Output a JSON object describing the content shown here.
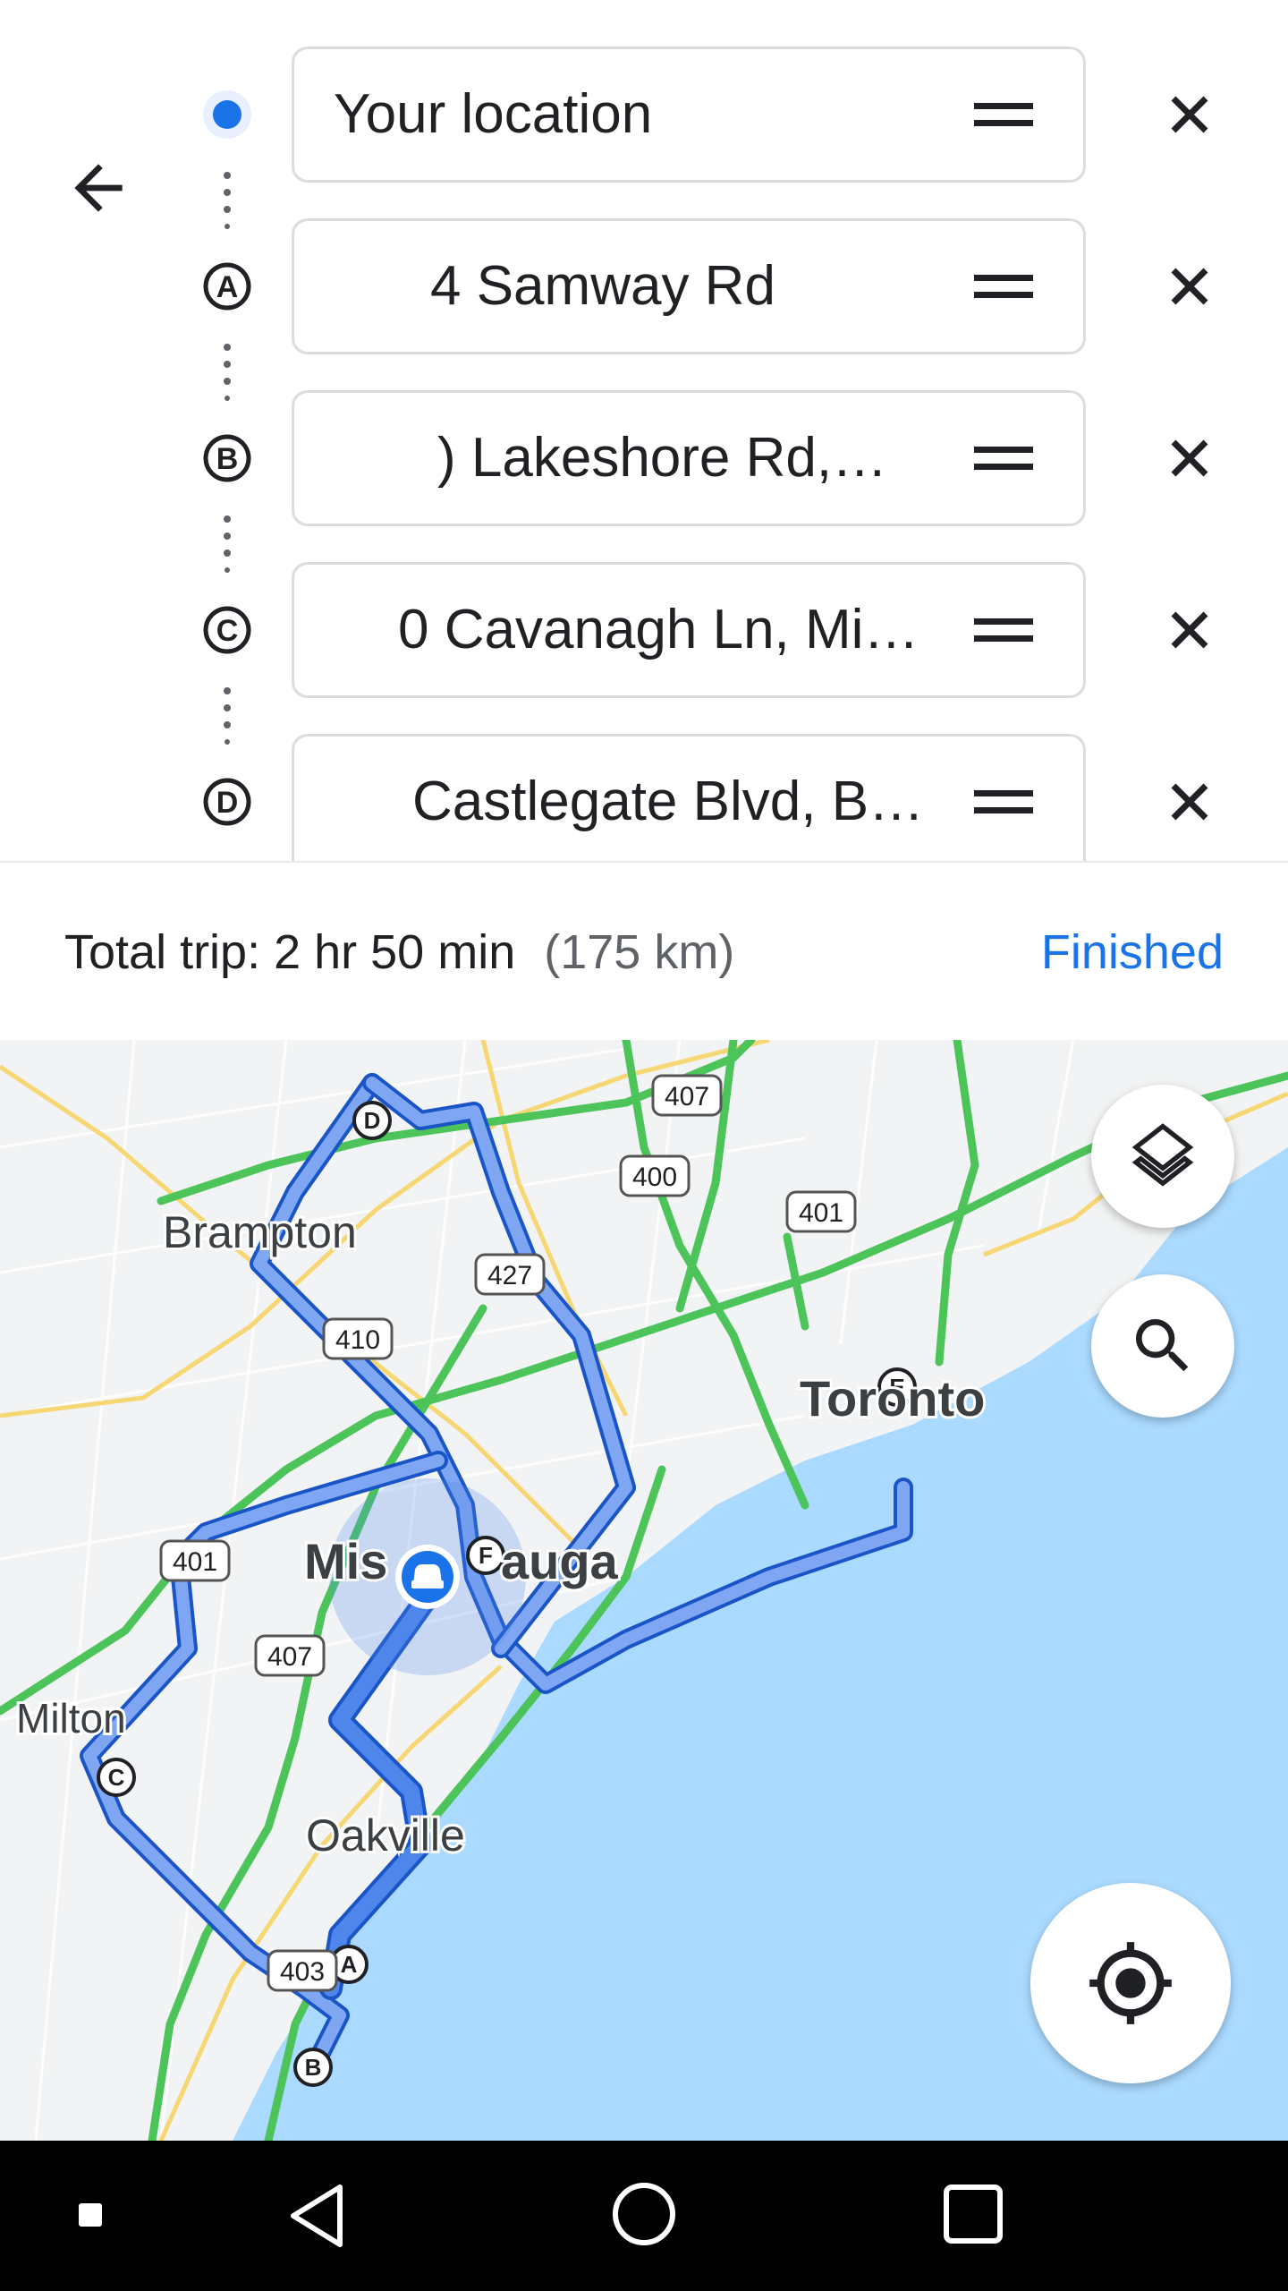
{
  "directions": {
    "stops": [
      {
        "marker": "",
        "text": "Your location"
      },
      {
        "marker": "A",
        "text": "4 Samway Rd"
      },
      {
        "marker": "B",
        "text": ") Lakeshore Rd,…"
      },
      {
        "marker": "C",
        "text": "0 Cavanagh Ln, Mi…"
      },
      {
        "marker": "D",
        "text": "Castlegate Blvd, B…"
      }
    ]
  },
  "summary": {
    "trip_label": "Total trip: 2 hr 50 min",
    "distance": "(175 km)",
    "finished_label": "Finished"
  },
  "map": {
    "cities": [
      "Brampton",
      "Toronto",
      "Mis",
      "auga",
      "Milton",
      "Oakville"
    ],
    "highways": [
      "407",
      "400",
      "401",
      "427",
      "410",
      "401",
      "407",
      "403"
    ],
    "waypoints": [
      "D",
      "E",
      "F",
      "C",
      "A",
      "B"
    ]
  },
  "colors": {
    "accent": "#1a73e8",
    "route": "#4f86ec",
    "route_casing": "#1a55c8",
    "traffic_green": "#4cc45a",
    "water": "#aadaff",
    "land": "#f1f3f4"
  },
  "icons": {
    "back": "arrow-left-icon",
    "drag": "drag-handle-icon",
    "remove": "close-icon",
    "layers": "layers-icon",
    "search": "search-icon",
    "locate": "my-location-icon",
    "car": "car-icon"
  }
}
